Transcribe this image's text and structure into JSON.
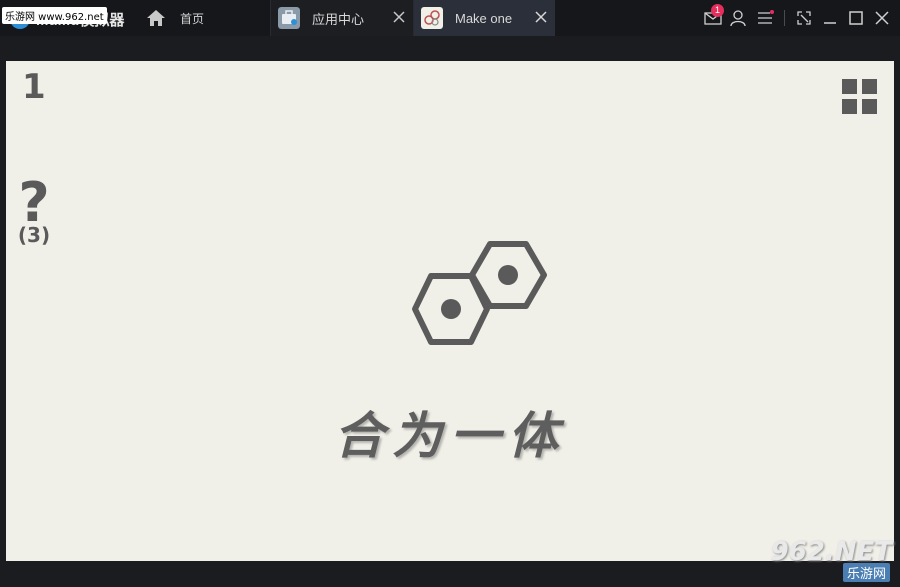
{
  "titlebar": {
    "app_name": "MuMu模拟器",
    "watermark": "乐游网 www.962.net",
    "home_label": "首页",
    "tabs": [
      {
        "label": "应用中心",
        "icon": "briefcase-icon"
      },
      {
        "label": "Make one",
        "icon": "hexagons-app-icon",
        "active": true
      }
    ],
    "notification_count": "1",
    "controls": [
      "mail-icon",
      "user-icon",
      "menu-icon",
      "screenshot-icon",
      "minimize-icon",
      "maximize-icon",
      "close-icon"
    ]
  },
  "game": {
    "level": "1",
    "hint_mark": "?",
    "hint_count": "(3)",
    "title": "合为一体",
    "background_color": "#f0efe8",
    "ink_color": "#5a5a5a"
  },
  "watermark_br": {
    "line1": "962.NET",
    "line2": "乐游网"
  }
}
